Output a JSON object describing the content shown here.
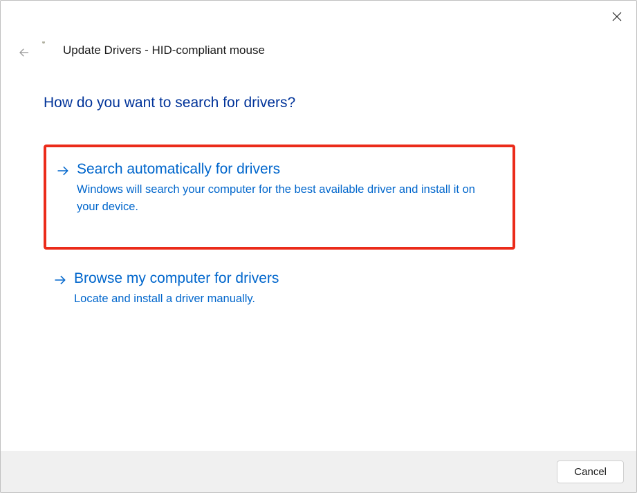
{
  "window": {
    "title": "Update Drivers - HID-compliant mouse"
  },
  "heading": "How do you want to search for drivers?",
  "options": [
    {
      "title": "Search automatically for drivers",
      "description": "Windows will search your computer for the best available driver and install it on your device."
    },
    {
      "title": "Browse my computer for drivers",
      "description": "Locate and install a driver manually."
    }
  ],
  "footer": {
    "cancel_label": "Cancel"
  }
}
